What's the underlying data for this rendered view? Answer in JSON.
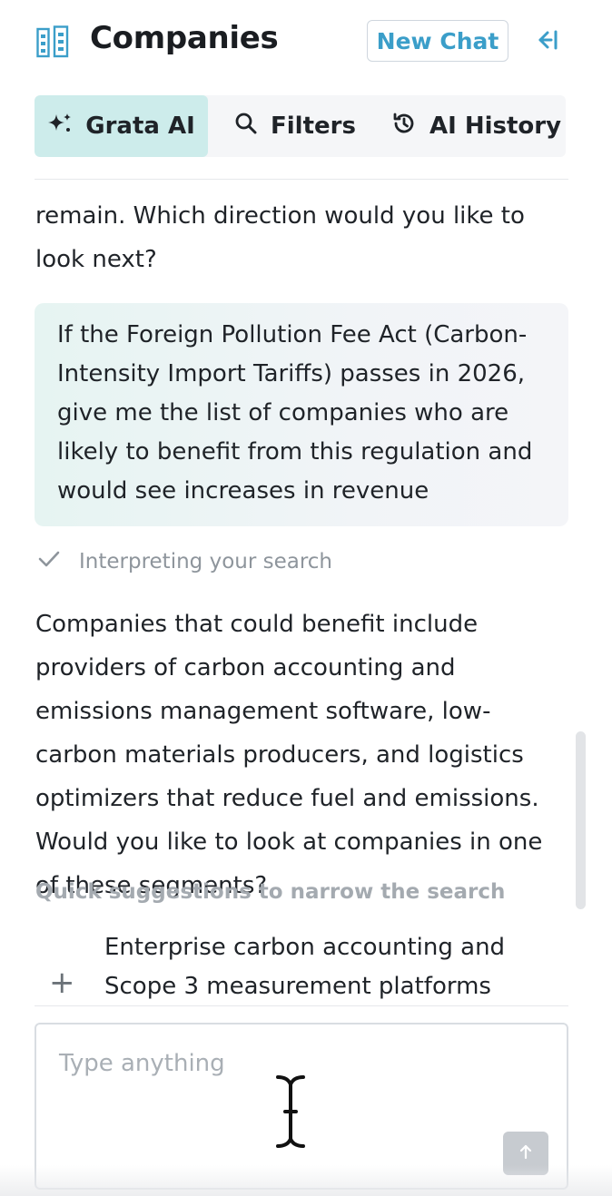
{
  "header": {
    "title": "Companies",
    "new_chat_label": "New Chat",
    "accent_color": "#3b9ec9"
  },
  "tabs": [
    {
      "label": "Grata AI",
      "icon": "sparkle-icon",
      "active": true
    },
    {
      "label": "Filters",
      "icon": "search-icon",
      "active": false
    },
    {
      "label": "AI History",
      "icon": "history-icon",
      "active": false
    }
  ],
  "chat": {
    "prev_reply_tail": "remain. Which direction would you like to look next?",
    "user_message": "If the Foreign Pollution Fee Act (Carbon-Intensity Import Tariffs) passes in 2026, give me the list of companies who are likely to benefit from this regulation and would see increases in revenue",
    "status": "Interpreting your search",
    "assistant_reply": "Companies that could benefit include providers of carbon accounting and emissions management software, low-carbon materials producers, and logistics optimizers that reduce fuel and emissions. Would you like to look at companies in one of these segments?",
    "suggestions_heading": "Quick suggestions to narrow the search",
    "suggestions": [
      {
        "text": "Enterprise carbon accounting and Scope 3 measurement platforms"
      }
    ]
  },
  "input": {
    "placeholder": "Type anything"
  }
}
